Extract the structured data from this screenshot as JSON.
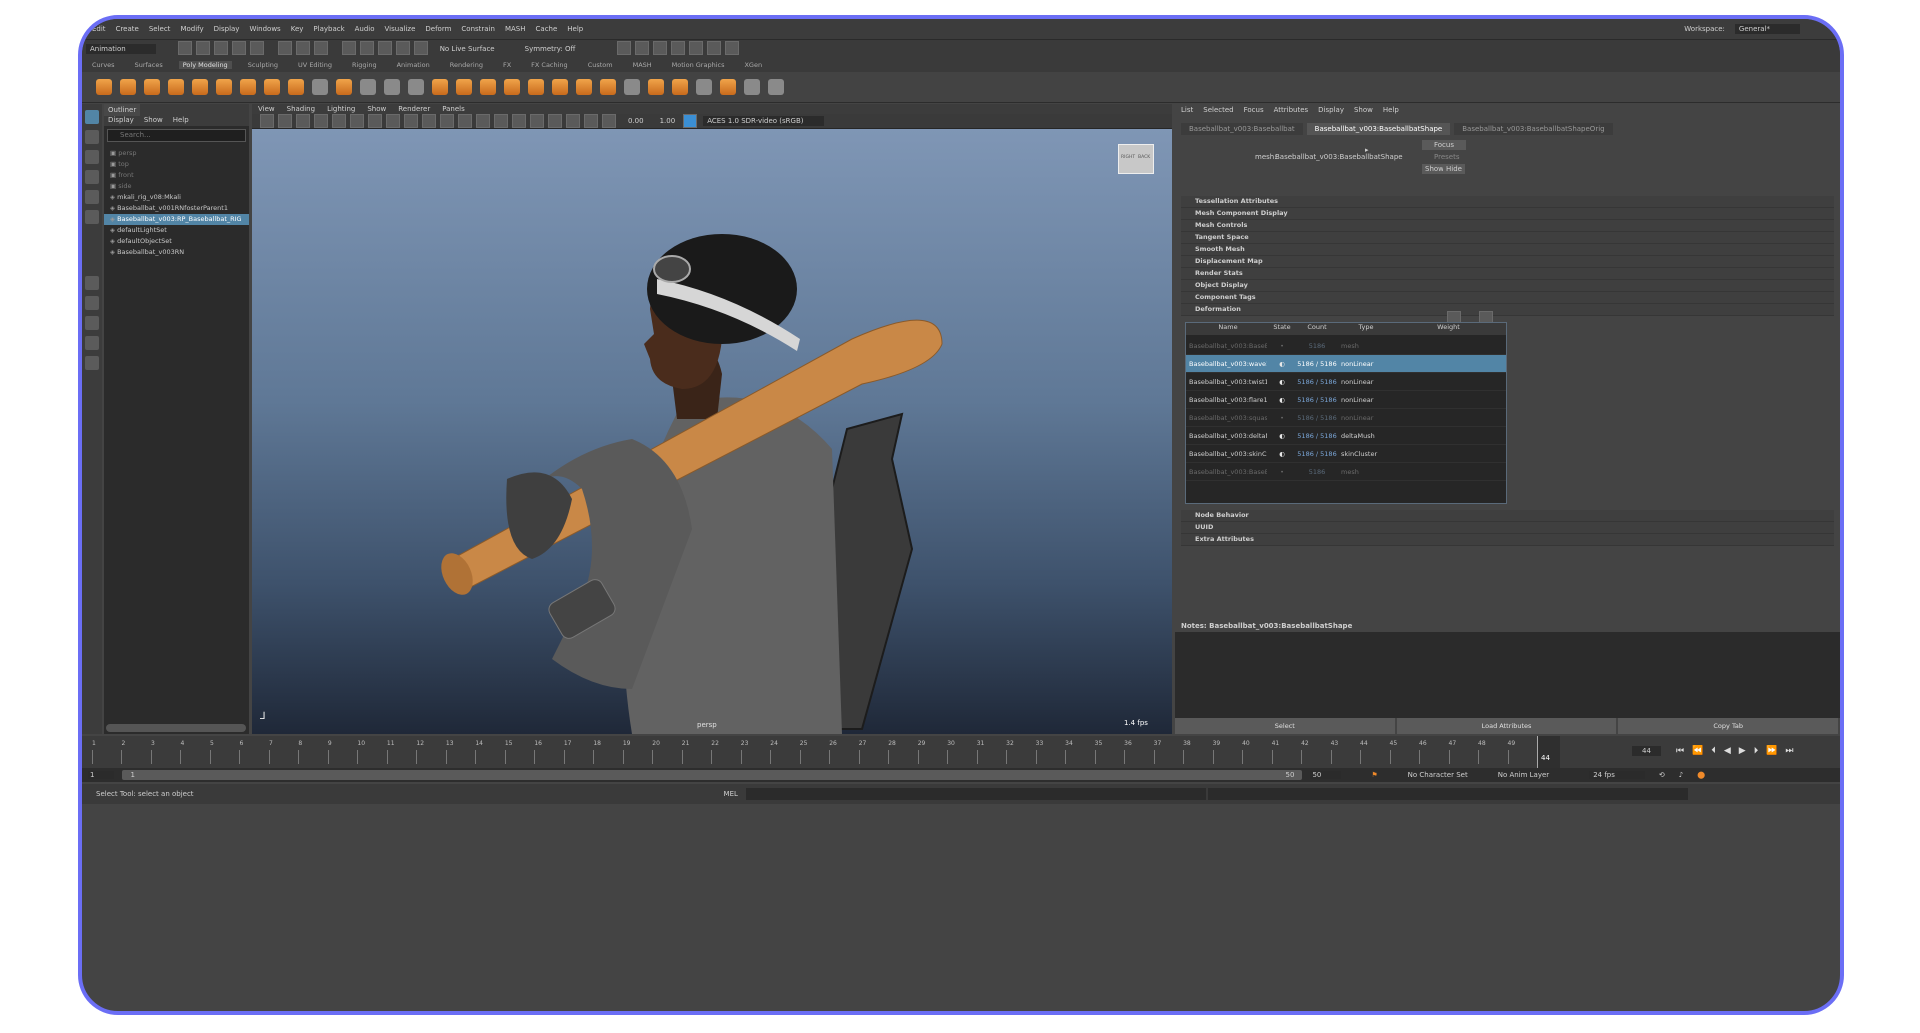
{
  "menubar": {
    "items": [
      "Edit",
      "Create",
      "Select",
      "Modify",
      "Display",
      "Windows",
      "Key",
      "Playback",
      "Audio",
      "Visualize",
      "Deform",
      "Constrain",
      "MASH",
      "Cache",
      "Help"
    ],
    "workspace_label": "Workspace:",
    "workspace_value": "General*"
  },
  "statusline": {
    "mode": "Animation",
    "live_surface": "No Live Surface",
    "symmetry": "Symmetry: Off"
  },
  "shelf_tabs": [
    "Curves",
    "Surfaces",
    "Poly Modeling",
    "Sculpting",
    "UV Editing",
    "Rigging",
    "Animation",
    "Rendering",
    "FX",
    "FX Caching",
    "Custom",
    "MASH",
    "Motion Graphics",
    "XGen"
  ],
  "shelf_active": "Poly Modeling",
  "outliner": {
    "title": "Outliner",
    "menu": [
      "Display",
      "Show",
      "Help"
    ],
    "search_placeholder": "Search...",
    "items": [
      "persp",
      "top",
      "front",
      "side",
      "mkali_rig_v08:Mkali",
      "Baseballbat_v001RNfosterParent1",
      "Baseballbat_v003:RP_Baseballbat_RIG",
      "defaultLightSet",
      "defaultObjectSet",
      "Baseballbat_v003RN"
    ],
    "selected_index": 6
  },
  "viewport": {
    "menu": [
      "View",
      "Shading",
      "Lighting",
      "Show",
      "Renderer",
      "Panels"
    ],
    "val_a": "0.00",
    "val_b": "1.00",
    "colorspace": "ACES 1.0 SDR-video (sRGB)",
    "camera": "persp",
    "fps": "1.4 fps",
    "cube_right": "RIGHT",
    "cube_back": "BACK"
  },
  "attribute_editor": {
    "menu": [
      "List",
      "Selected",
      "Focus",
      "Attributes",
      "Display",
      "Show",
      "Help"
    ],
    "tabs": [
      "Baseballbat_v003:Baseballbat",
      "Baseballbat_v003:BaseballbatShape",
      "Baseballbat_v003:BaseballbatShapeOrig"
    ],
    "active_tab": 1,
    "mesh_label": "mesh:",
    "mesh_value": "Baseballbat_v003:BaseballbatShape",
    "focus_btn": "Focus",
    "presets_btn": "Presets",
    "show_btn": "Show",
    "hide_btn": "Hide",
    "sections": [
      "Tessellation Attributes",
      "Mesh Component Display",
      "Mesh Controls",
      "Tangent Space",
      "Smooth Mesh",
      "Displacement Map",
      "Render Stats",
      "Object Display",
      "Component Tags",
      "Deformation"
    ],
    "sections_after": [
      "Node Behavior",
      "UUID",
      "Extra Attributes"
    ],
    "notes": "Notes:  Baseballbat_v003:BaseballbatShape",
    "buttons": [
      "Select",
      "Load Attributes",
      "Copy Tab"
    ]
  },
  "deform_table": {
    "headers": [
      "Name",
      "State",
      "Count",
      "Type",
      "Weight"
    ],
    "rows": [
      {
        "name": "Baseballbat_v003:BaseB...",
        "count": "5186",
        "type": "mesh",
        "selected": false,
        "dim": true,
        "toggle": false
      },
      {
        "name": "Baseballbat_v003:wave1",
        "count": "5186 / 5186",
        "type": "nonLinear",
        "selected": true,
        "dim": false,
        "toggle": true
      },
      {
        "name": "Baseballbat_v003:twist1",
        "count": "5186 / 5186",
        "type": "nonLinear",
        "selected": false,
        "dim": false,
        "toggle": true
      },
      {
        "name": "Baseballbat_v003:flare1",
        "count": "5186 / 5186",
        "type": "nonLinear",
        "selected": false,
        "dim": false,
        "toggle": true
      },
      {
        "name": "Baseballbat_v003:squash1",
        "count": "5186 / 5186",
        "type": "nonLinear",
        "selected": false,
        "dim": true,
        "toggle": false
      },
      {
        "name": "Baseballbat_v003:deltaM...",
        "count": "5186 / 5186",
        "type": "deltaMush",
        "selected": false,
        "dim": false,
        "toggle": true
      },
      {
        "name": "Baseballbat_v003:skinCl...",
        "count": "5186 / 5186",
        "type": "skinCluster",
        "selected": false,
        "dim": false,
        "toggle": true
      },
      {
        "name": "Baseballbat_v003:BaseB...",
        "count": "5186",
        "type": "mesh",
        "selected": false,
        "dim": true,
        "toggle": false
      }
    ]
  },
  "timeline": {
    "ticks": [
      "1",
      "2",
      "3",
      "4",
      "5",
      "6",
      "7",
      "8",
      "9",
      "10",
      "11",
      "12",
      "13",
      "14",
      "15",
      "16",
      "17",
      "18",
      "19",
      "20",
      "21",
      "22",
      "23",
      "24",
      "25",
      "26",
      "27",
      "28",
      "29",
      "30",
      "31",
      "32",
      "33",
      "34",
      "35",
      "36",
      "37",
      "38",
      "39",
      "40",
      "41",
      "42",
      "43",
      "44",
      "45",
      "46",
      "47",
      "48",
      "49",
      "50"
    ],
    "current": "44",
    "current_field": "44",
    "range_start": "1",
    "range_start_inner": "1",
    "range_end_inner": "50",
    "range_end": "50",
    "character_set": "No Character Set",
    "anim_layer": "No Anim Layer",
    "fps": "24 fps"
  },
  "command": {
    "help_text": "Select Tool: select an object",
    "lang": "MEL"
  }
}
